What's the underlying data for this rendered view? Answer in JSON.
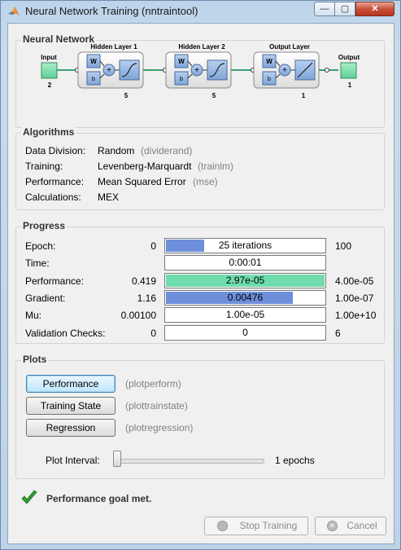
{
  "window": {
    "title": "Neural Network Training (nntraintool)",
    "min_glyph": "—",
    "max_glyph": "▢",
    "close_glyph": "✕"
  },
  "network": {
    "section_title": "Neural Network",
    "input_label": "Input",
    "input_size": "2",
    "hidden1_title": "Hidden Layer 1",
    "hidden1_size": "5",
    "hidden2_title": "Hidden Layer 2",
    "hidden2_size": "5",
    "output_layer_title": "Output Layer",
    "output_layer_size": "1",
    "output_label": "Output",
    "output_size": "1",
    "w_label": "W",
    "b_label": "b",
    "plus_label": "+"
  },
  "algorithms": {
    "section_title": "Algorithms",
    "rows": [
      {
        "label": "Data Division:",
        "value": "Random",
        "func": "(dividerand)"
      },
      {
        "label": "Training:",
        "value": "Levenberg-Marquardt",
        "func": "(trainlm)"
      },
      {
        "label": "Performance:",
        "value": "Mean Squared Error",
        "func": "(mse)"
      },
      {
        "label": "Calculations:",
        "value": "MEX",
        "func": ""
      }
    ]
  },
  "progress": {
    "section_title": "Progress",
    "rows": [
      {
        "label": "Epoch:",
        "start": "0",
        "bar_text": "25 iterations",
        "end": "100",
        "fill": 0.25,
        "color": "#6d8fdb"
      },
      {
        "label": "Time:",
        "start": "",
        "bar_text": "0:00:01",
        "end": "",
        "fill": 0,
        "color": "#6d8fdb"
      },
      {
        "label": "Performance:",
        "start": "0.419",
        "bar_text": "2.97e-05",
        "end": "4.00e-05",
        "fill": 1.0,
        "color": "#6fdcae"
      },
      {
        "label": "Gradient:",
        "start": "1.16",
        "bar_text": "0.00476",
        "end": "1.00e-07",
        "fill": 0.8,
        "color": "#6d8fdb"
      },
      {
        "label": "Mu:",
        "start": "0.00100",
        "bar_text": "1.00e-05",
        "end": "1.00e+10",
        "fill": 0,
        "color": "#6d8fdb"
      },
      {
        "label": "Validation Checks:",
        "start": "0",
        "bar_text": "0",
        "end": "6",
        "fill": 0,
        "color": "#6d8fdb"
      }
    ]
  },
  "plots": {
    "section_title": "Plots",
    "buttons": [
      {
        "label": "Performance",
        "func": "(plotperform)"
      },
      {
        "label": "Training State",
        "func": "(plottrainstate)"
      },
      {
        "label": "Regression",
        "func": "(plotregression)"
      }
    ],
    "interval_label": "Plot Interval:",
    "interval_value": "1 epochs"
  },
  "status": {
    "message": "Performance goal met.",
    "check_color": "#2e9e2e"
  },
  "footer": {
    "stop_label": "Stop Training",
    "cancel_label": "Cancel"
  }
}
